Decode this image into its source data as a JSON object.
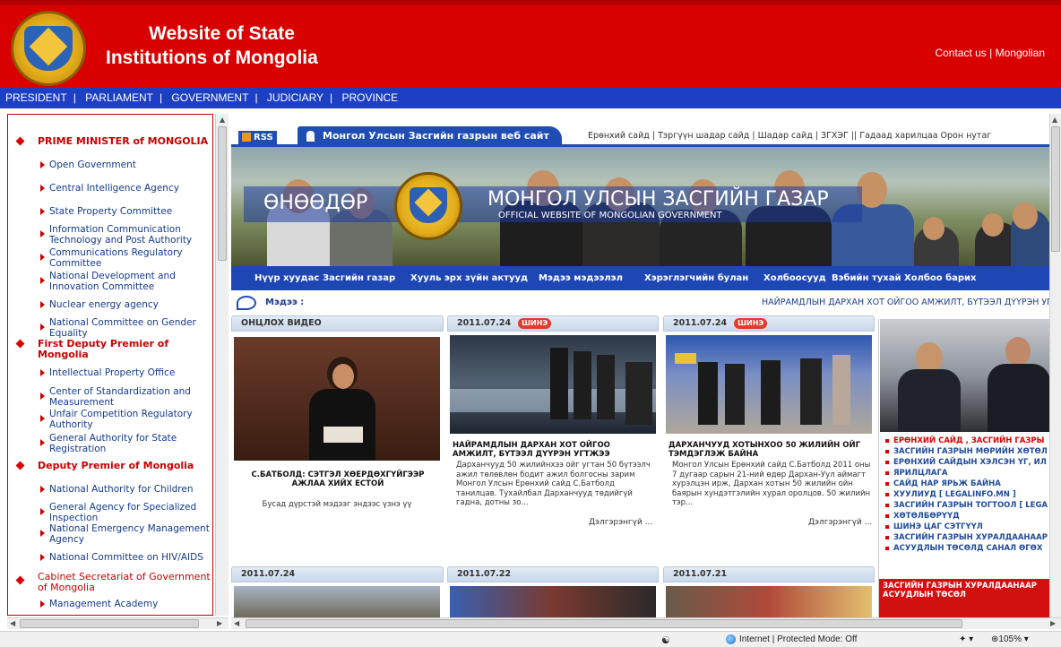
{
  "header": {
    "title_line1": "Website of State",
    "title_line2": "Institutions of Mongolia",
    "contact": "Contact us",
    "sep": "|",
    "lang": "Mongolian"
  },
  "topnav": [
    "PRESIDENT",
    "PARLIAMENT",
    "GOVERNMENT",
    "JUDICIARY",
    "PROVINCE"
  ],
  "sidebar": {
    "items": [
      {
        "label": "PRIME MINISTER of MONGOLIA",
        "type": "section"
      },
      {
        "label": "Open Government",
        "type": "link"
      },
      {
        "label": "Central Intelligence Agency",
        "type": "link"
      },
      {
        "label": "State Property Committee",
        "type": "link"
      },
      {
        "label": "Information Communication Technology and Post Authority",
        "type": "link"
      },
      {
        "label": "Communications Regulatory Committee",
        "type": "link"
      },
      {
        "label": "National Development and Innovation Committee",
        "type": "link"
      },
      {
        "label": "Nuclear energy agency",
        "type": "link"
      },
      {
        "label": "National Committee on Gender Equality",
        "type": "link"
      },
      {
        "label": "First Deputy Premier of Mongolia",
        "type": "section"
      },
      {
        "label": "Intellectual Property Office",
        "type": "link"
      },
      {
        "label": "Center of Standardization and Measurement",
        "type": "link"
      },
      {
        "label": "Unfair Competition Regulatory Authority",
        "type": "link"
      },
      {
        "label": "General Authority for State Registration",
        "type": "link"
      },
      {
        "label": "Deputy Premier of Mongolia",
        "type": "section"
      },
      {
        "label": "National Authority for Children",
        "type": "link"
      },
      {
        "label": "General Agency for Specialized Inspection",
        "type": "link"
      },
      {
        "label": "National Emergency Management Agency",
        "type": "link"
      },
      {
        "label": "National Committee on HIV/AIDS",
        "type": "link"
      },
      {
        "label": "Cabinet Secretariat of Government of Mongolia",
        "type": "section"
      },
      {
        "label": "Management Academy",
        "type": "link"
      }
    ]
  },
  "gov": {
    "rss": "RSS",
    "site_name": "Монгол Улсын Засгийн газрын веб сайт",
    "toplinks": "Ерөнхий сайд  |  Тэргүүн шадар сайд  |  Шадар сайд  |  ЗГХЭГ  ||  Гадаад харилцаа  Орон нутаг",
    "banner_today": "ӨНӨӨДӨР",
    "banner_title": "МОНГОЛ УЛСЫН ЗАСГИЙН ГАЗАР",
    "banner_sub": "OFFICIAL WEBSITE OF MONGOLIAN GOVERNMENT",
    "menu": [
      "Нүүр хуудас",
      "Засгийн газар",
      "Хууль эрх зүйн актууд",
      "Мэдээ мэдээлэл",
      "Хэрэглэгчийн булан",
      "Холбоосууд",
      "Вэбийн тухай",
      "Холбоо барих"
    ],
    "news_label": "Мэдээ :",
    "ticker": "НАЙРАМДЛЫН ДАРХАН ХОТ ОЙГОО АМЖИЛТ, БҮТЭЭЛ ДҮҮРЭН УГТЖЭ"
  },
  "cards": {
    "video_head": "ОНЦЛОХ ВИДЕО",
    "video_title": "С.БАТБОЛД: СЭТГЭЛ ХӨЕРДӨХГҮЙГЭЭР АЖЛАА ХИЙХ ЕСТОЙ",
    "video_more": "Бусад дүрстэй мэдээг эндээс үзнэ үү",
    "c2_date": "2011.07.24",
    "c2_badge": "ШИНЭ",
    "c2_title": "НАЙРАМДЛЫН ДАРХАН ХОТ ОЙГОО АМЖИЛТ, БҮТЭЭЛ ДҮҮРЭН УГТЖЭЭ",
    "c2_body": "Дарханчууд 50 жилийнхээ ойг угтан 50 бүтээлч ажил төлөвлөн бодит ажил болгосны зарим Монгол Улсын Ерөнхий сайд С.Батболд танилцав. Тухайлбал Дарханчууд төдийгүй гадна, дотны зо...",
    "c2_more": "Дэлгэрэнгүй ...",
    "c3_date": "2011.07.24",
    "c3_badge": "ШИНЭ",
    "c3_title": "ДАРХАНЧУУД ХОТЫНХОО 50 ЖИЛИЙН ОЙГ ТЭМДЭГЛЭЖ БАЙНА",
    "c3_body": "Монгол Улсын Ерөнхий сайд С.Батболд 2011 оны 7 дугаар сарын 21-ний өдөр Дархан-Уул аймагт хурэлцэн ирж, Дархан хотын 50 жилийн ойн баярын хундэтгэлийн хурал оролцов. 50 жилийн тэр...",
    "c3_more": "Дэлгэрэнгүй ...",
    "r1_date": "2011.07.24",
    "r2_date": "2011.07.22",
    "r3_date": "2011.07.21"
  },
  "right": {
    "items": [
      "ЕРӨНХИЙ САЙД , ЗАСГИЙН ГАЗРЫ",
      "ЗАСГИЙН ГАЗРЫН МӨРИЙН ХӨТӨЛ",
      "ЕРӨНХИЙ САЙДЫН ХЭЛСЭН ҮГ, ИЛ",
      "ЯРИЛЦЛАГА",
      "САЙД НАР ЯРЬЖ БАЙНА",
      "ХУУЛИУД [ LEGALINFO.MN ]",
      "ЗАСГИЙН ГАЗРЫН ТОГТООЛ [ LEGA",
      "ХӨТӨЛБӨРҮҮД",
      "ШИНЭ ЦАГ СЭТГҮҮЛ",
      "ЗАСГИЙН ГАЗРЫН ХУРАЛДААНААР",
      "АСУУДЛЫН ТӨСӨЛД САНАЛ ӨГӨХ"
    ],
    "box": "ЗАСГИЙН ГАЗРЫН ХУРАЛДААНААР АСУУДЛЫН ТӨСӨЛ"
  },
  "status": {
    "zone": "Internet | Protected Mode: Off",
    "zoom": "105%"
  },
  "colors": {
    "header_red": "#d80000",
    "nav_blue": "#1c3fc3",
    "gov_blue": "#1f4db4"
  }
}
